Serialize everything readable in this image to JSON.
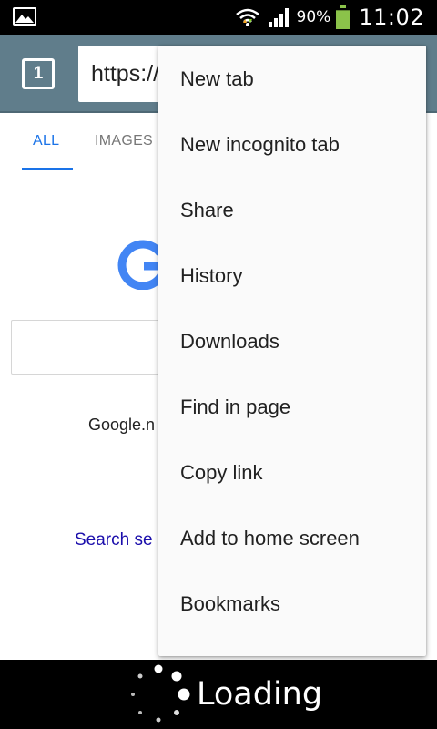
{
  "status_bar": {
    "battery_percent": "90%",
    "battery_level": 0.9,
    "time": "11:02",
    "icons": [
      "gallery-icon",
      "wifi-icon",
      "signal-icon",
      "battery-icon"
    ]
  },
  "toolbar": {
    "tab_count": "1",
    "url": "https://"
  },
  "page": {
    "tabs": [
      {
        "label": "ALL",
        "active": true
      },
      {
        "label": "IMAGES",
        "active": false
      }
    ],
    "domain_text": "Google.n",
    "search_settings_text": "Search se"
  },
  "menu": {
    "items": [
      {
        "label": "New tab"
      },
      {
        "label": "New incognito tab"
      },
      {
        "label": "Share"
      },
      {
        "label": "History"
      },
      {
        "label": "Downloads"
      },
      {
        "label": "Find in page"
      },
      {
        "label": "Copy link"
      },
      {
        "label": "Add to home screen"
      },
      {
        "label": "Bookmarks"
      }
    ]
  },
  "loading": {
    "label": "Loading"
  },
  "colors": {
    "toolbar": "#607d8b",
    "accent_blue": "#1a73e8",
    "link_blue": "#1a0dab",
    "battery_green": "#8bc34a"
  }
}
